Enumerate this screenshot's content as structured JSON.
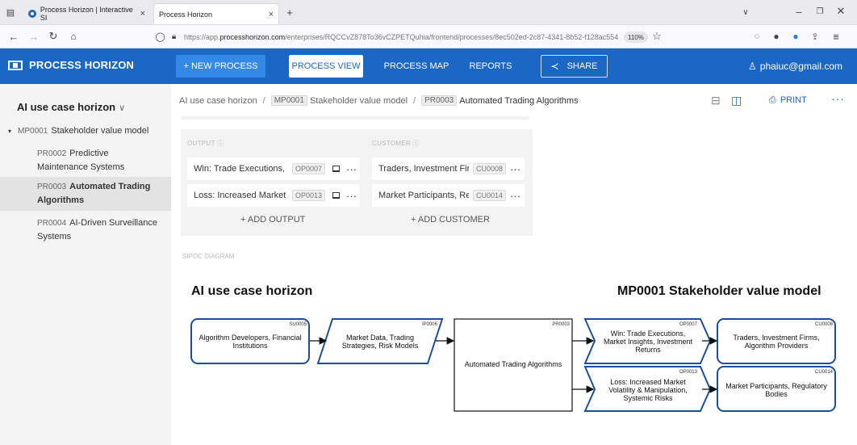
{
  "browser": {
    "tabs": [
      {
        "label": "Process Horizon | Interactive SI",
        "close": "×"
      },
      {
        "label": "Process Horizon",
        "close": "×"
      }
    ],
    "new_tab": "+",
    "url_prefix": "https://app.",
    "url_domain": "processhorizon.com",
    "url_rest": "/enterprises/RQCCvZ878To36vCZPETQuhia/frontend/processes/8ec502ed-2c87-4341-8b52-f128ac554",
    "zoom": "110%"
  },
  "app": {
    "logo_text": "PROCESS HORIZON",
    "nav": {
      "new_process": "+ NEW PROCESS",
      "process_view": "PROCESS VIEW",
      "process_map": "PROCESS MAP",
      "reports": "REPORTS",
      "share": "SHARE"
    },
    "user": "phaiuc@gmail.com"
  },
  "sidebar": {
    "title": "AI use case horizon",
    "root": {
      "code": "MP0001",
      "label": "Stakeholder value model"
    },
    "items": [
      {
        "code": "PR0002",
        "label": "Predictive Maintenance Systems"
      },
      {
        "code": "PR0003",
        "label": "Automated Trading Algorithms"
      },
      {
        "code": "PR0004",
        "label": "AI-Driven Surveillance Systems"
      }
    ]
  },
  "breadcrumb": {
    "root": "AI use case horizon",
    "model_code": "MP0001",
    "model_label": "Stakeholder value model",
    "process_code": "PR0003",
    "process_label": "Automated Trading Algorithms",
    "sep": "/"
  },
  "toolbar": {
    "print": "PRINT"
  },
  "output": {
    "header": "OUTPUT ⓘ",
    "items": [
      {
        "text": "Win: Trade Executions, M",
        "code": "OP0007"
      },
      {
        "text": "Loss: Increased Market V",
        "code": "OP0013"
      }
    ],
    "add": "+ ADD OUTPUT"
  },
  "customer": {
    "header": "CUSTOMER ⓘ",
    "items": [
      {
        "text": "Traders, Investment Firm",
        "code": "CU0008"
      },
      {
        "text": "Market Participants, Reg",
        "code": "CU0014"
      }
    ],
    "add": "+ ADD CUSTOMER"
  },
  "diagram": {
    "label": "SIPOC DIAGRAM",
    "left_title": "AI use case horizon",
    "right_title": "MP0001 Stakeholder value model",
    "supplier": {
      "code": "SU0005",
      "lines": [
        "Algorithm Developers, Financial",
        "Institutions"
      ]
    },
    "input": {
      "code": "IP0006",
      "lines": [
        "Market Data, Trading",
        "Strategies, Risk Models"
      ]
    },
    "process": {
      "code": "PR0003",
      "lines": [
        "Automated Trading Algorithms"
      ]
    },
    "output1": {
      "code": "OP0007",
      "lines": [
        "Win: Trade Executions,",
        "Market Insights, Investment",
        "Returns"
      ]
    },
    "output2": {
      "code": "OP0013",
      "lines": [
        "Loss: Increased Market",
        "Volatility & Manipulation,",
        "Systemic Risks"
      ]
    },
    "customer1": {
      "code": "CU0008",
      "lines": [
        "Traders, Investment Firms,",
        "Algorithm Providers"
      ]
    },
    "customer2": {
      "code": "CU0014",
      "lines": [
        "Market Participants, Regulatory",
        "Bodies"
      ]
    }
  }
}
